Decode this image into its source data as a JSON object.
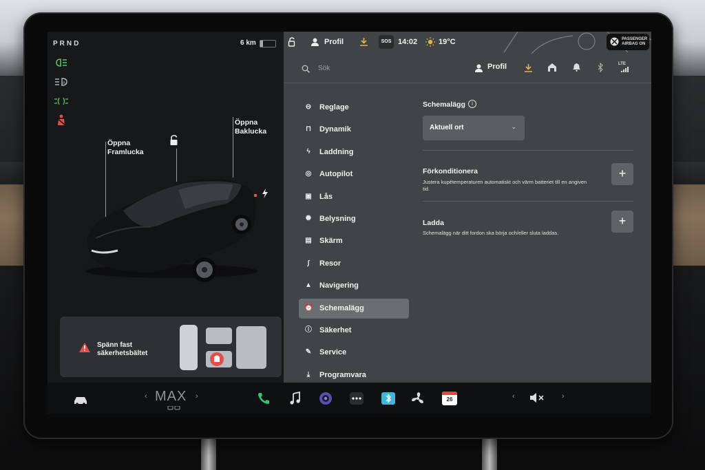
{
  "colors": {
    "accent_yellow": "#e0b44a",
    "telltale_green": "#49c45b",
    "warning_red": "#e0504a",
    "active_item_bg": "#6b6e71",
    "phone_green": "#37c26c",
    "calendar_red": "#e04a3a"
  },
  "left_panel": {
    "gear": "PRND",
    "range": "6 km",
    "battery_level": 0.2,
    "telltales": [
      "headlight-icon",
      "auto-highbeam-icon",
      "parking-lights-icon",
      "seatbelt-warning-icon"
    ],
    "front_trunk": "Öppna\nFramlucka",
    "rear_trunk": "Öppna\nBaklucka",
    "front_trunk_l1": "Öppna",
    "front_trunk_l2": "Framlucka",
    "rear_trunk_l1": "Öppna",
    "rear_trunk_l2": "Baklucka",
    "seatbelt_alert_l1": "Spänn fast",
    "seatbelt_alert_l2": "säkerhetsbältet"
  },
  "status_bar": {
    "profile": "Profil",
    "sos": "SOS",
    "time": "14:02",
    "temperature": "19°C",
    "passenger_airbag_l1": "PASSENGER",
    "passenger_airbag_l2": "AIRBAG ON"
  },
  "top_bar": {
    "search_placeholder": "Sök",
    "profile": "Profil",
    "network": "LTE"
  },
  "menu": [
    {
      "label": "Reglage",
      "icon": "toggle-icon"
    },
    {
      "label": "Dynamik",
      "icon": "car-icon"
    },
    {
      "label": "Laddning",
      "icon": "bolt-icon"
    },
    {
      "label": "Autopilot",
      "icon": "steering-wheel-icon"
    },
    {
      "label": "Lås",
      "icon": "lock-icon"
    },
    {
      "label": "Belysning",
      "icon": "sun-icon"
    },
    {
      "label": "Skärm",
      "icon": "display-icon"
    },
    {
      "label": "Resor",
      "icon": "trip-icon"
    },
    {
      "label": "Navigering",
      "icon": "navigation-icon"
    },
    {
      "label": "Schemalägg",
      "icon": "alarm-clock-icon",
      "active": true
    },
    {
      "label": "Säkerhet",
      "icon": "info-icon"
    },
    {
      "label": "Service",
      "icon": "wrench-icon"
    },
    {
      "label": "Programvara",
      "icon": "download-icon"
    }
  ],
  "schedule": {
    "title": "Schemalägg",
    "location_value": "Aktuell ort",
    "precondition": {
      "title": "Förkonditionera",
      "desc": "Justera kupétemperaturen automatiskt och värm batteriet till en angiven tid."
    },
    "charge": {
      "title": "Ladda",
      "desc": "Schemalägg när ditt fordon ska börja och/eller sluta laddas."
    }
  },
  "dock": {
    "fan": "MAX",
    "calendar_day": "26",
    "apps": [
      "car-icon",
      "phone-icon",
      "music-icon",
      "camera-icon",
      "more-icon",
      "bluetooth-icon",
      "fan-icon",
      "calendar-icon"
    ]
  }
}
